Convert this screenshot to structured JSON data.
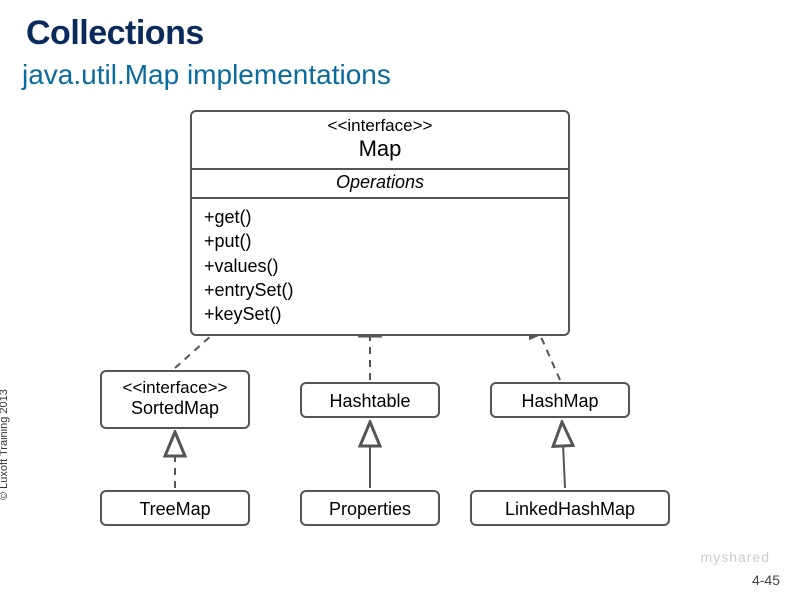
{
  "title": "Collections",
  "subtitle": "java.util.Map implementations",
  "interface_stereotype": "<<interface>>",
  "map": {
    "name": "Map",
    "ops_header": "Operations",
    "operations": [
      "+get()",
      "+put()",
      "+values()",
      "+entrySet()",
      "+keySet()"
    ]
  },
  "nodes": {
    "sortedmap": {
      "stereo": "<<interface>>",
      "name": "SortedMap"
    },
    "hashtable": "Hashtable",
    "hashmap": "HashMap",
    "treemap": "TreeMap",
    "properties": "Properties",
    "linkedhashmap": "LinkedHashMap"
  },
  "copyright": "© Luxoft Training 2013",
  "page_number": "4-45",
  "watermark": "myshared"
}
